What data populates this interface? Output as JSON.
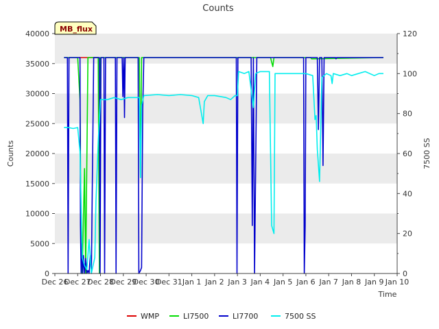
{
  "chart_data": {
    "type": "line",
    "title": "Counts",
    "badge": "MB_flux",
    "xlabel": "Time",
    "ylabel_left": "Counts",
    "ylabel_right": "7500 SS",
    "ylim_left": [
      0,
      40000
    ],
    "ylim_right": [
      0,
      120
    ],
    "xlim": [
      0,
      15
    ],
    "grid": "horizontal bands",
    "legend_position": "bottom",
    "x_ticks": [
      {
        "pos": 0,
        "label": "Dec 26"
      },
      {
        "pos": 1,
        "label": "Dec 27"
      },
      {
        "pos": 2,
        "label": "Dec 28"
      },
      {
        "pos": 3,
        "label": "Dec 29"
      },
      {
        "pos": 4,
        "label": "Dec 30"
      },
      {
        "pos": 5,
        "label": "Dec 31"
      },
      {
        "pos": 6,
        "label": "Jan 1"
      },
      {
        "pos": 7,
        "label": "Jan 2"
      },
      {
        "pos": 8,
        "label": "Jan 3"
      },
      {
        "pos": 9,
        "label": "Jan 4"
      },
      {
        "pos": 10,
        "label": "Jan 5"
      },
      {
        "pos": 11,
        "label": "Jan 6"
      },
      {
        "pos": 12,
        "label": "Jan 7"
      },
      {
        "pos": 13,
        "label": "Jan 8"
      },
      {
        "pos": 14,
        "label": "Jan 9"
      },
      {
        "pos": 15,
        "label": "Jan 10"
      }
    ],
    "y_ticks_left": [
      0,
      5000,
      10000,
      15000,
      20000,
      25000,
      30000,
      35000,
      40000
    ],
    "y_ticks_right": [
      0,
      20,
      40,
      60,
      80,
      100,
      120
    ],
    "series": [
      {
        "name": "WMP",
        "color": "#dd0000",
        "axis": "left",
        "points": [
          [
            1.05,
            36000
          ],
          [
            1.9,
            36000
          ]
        ]
      },
      {
        "name": "LI7500",
        "color": "#00dd00",
        "axis": "left",
        "points": [
          [
            0.4,
            36000
          ],
          [
            1.0,
            36000
          ],
          [
            1.1,
            29000
          ],
          [
            1.15,
            4000
          ],
          [
            1.2,
            0
          ],
          [
            1.3,
            17500
          ],
          [
            1.35,
            0
          ],
          [
            1.45,
            36000
          ],
          [
            1.9,
            36000
          ],
          [
            1.95,
            0
          ],
          [
            2.0,
            36000
          ],
          [
            3.7,
            36000
          ],
          [
            3.75,
            16000
          ],
          [
            3.8,
            36000
          ],
          [
            9.45,
            36000
          ],
          [
            9.55,
            34500
          ],
          [
            9.6,
            36000
          ],
          [
            11.2,
            36000
          ],
          [
            11.25,
            35800
          ],
          [
            14.4,
            36000
          ]
        ]
      },
      {
        "name": "LI7700",
        "color": "#0000cc",
        "axis": "left",
        "points": [
          [
            0.4,
            36000
          ],
          [
            0.55,
            36000
          ],
          [
            0.58,
            0
          ],
          [
            0.62,
            36000
          ],
          [
            1.1,
            36000
          ],
          [
            1.12,
            8000
          ],
          [
            1.15,
            0
          ],
          [
            1.18,
            5000
          ],
          [
            1.22,
            0
          ],
          [
            1.25,
            3000
          ],
          [
            1.3,
            0
          ],
          [
            1.35,
            2500
          ],
          [
            1.4,
            0
          ],
          [
            1.45,
            500
          ],
          [
            1.5,
            0
          ],
          [
            1.55,
            3000
          ],
          [
            1.6,
            0
          ],
          [
            1.7,
            36000
          ],
          [
            1.95,
            36000
          ],
          [
            1.98,
            0
          ],
          [
            2.02,
            36000
          ],
          [
            2.15,
            36000
          ],
          [
            2.18,
            0
          ],
          [
            2.22,
            36000
          ],
          [
            2.65,
            36000
          ],
          [
            2.68,
            0
          ],
          [
            2.72,
            36000
          ],
          [
            2.95,
            36000
          ],
          [
            2.98,
            29500
          ],
          [
            3.02,
            36000
          ],
          [
            3.05,
            26000
          ],
          [
            3.08,
            36000
          ],
          [
            3.65,
            36000
          ],
          [
            3.68,
            0
          ],
          [
            3.75,
            500
          ],
          [
            3.8,
            1000
          ],
          [
            3.85,
            27500
          ],
          [
            3.9,
            36000
          ],
          [
            7.95,
            36000
          ],
          [
            7.98,
            0
          ],
          [
            8.02,
            36000
          ],
          [
            8.6,
            36000
          ],
          [
            8.65,
            8000
          ],
          [
            8.7,
            36000
          ],
          [
            8.75,
            0
          ],
          [
            8.8,
            17500
          ],
          [
            8.85,
            36000
          ],
          [
            9.0,
            36000
          ],
          [
            9.05,
            36000
          ],
          [
            9.8,
            36000
          ],
          [
            10.9,
            36000
          ],
          [
            10.93,
            0
          ],
          [
            10.97,
            8000
          ],
          [
            11.0,
            36000
          ],
          [
            11.5,
            36000
          ],
          [
            11.55,
            24000
          ],
          [
            11.6,
            36000
          ],
          [
            11.7,
            36000
          ],
          [
            11.75,
            18000
          ],
          [
            11.8,
            36000
          ],
          [
            12.3,
            36000
          ],
          [
            12.32,
            35800
          ],
          [
            12.35,
            36000
          ],
          [
            14.4,
            36000
          ]
        ]
      },
      {
        "name": "7500 SS",
        "color": "#00eeee",
        "axis": "right",
        "points": [
          [
            0.4,
            73
          ],
          [
            0.6,
            73
          ],
          [
            0.8,
            72.5
          ],
          [
            1.0,
            73
          ],
          [
            1.1,
            61
          ],
          [
            1.2,
            8
          ],
          [
            1.3,
            4
          ],
          [
            1.4,
            2
          ],
          [
            1.5,
            17
          ],
          [
            1.6,
            0
          ],
          [
            1.75,
            8
          ],
          [
            1.8,
            36
          ],
          [
            1.9,
            66
          ],
          [
            2.0,
            87
          ],
          [
            2.3,
            87
          ],
          [
            2.6,
            88
          ],
          [
            2.9,
            87
          ],
          [
            3.2,
            88
          ],
          [
            3.7,
            88
          ],
          [
            3.75,
            48
          ],
          [
            3.8,
            84
          ],
          [
            3.9,
            89
          ],
          [
            4.5,
            89.5
          ],
          [
            5.0,
            89
          ],
          [
            5.5,
            89.5
          ],
          [
            6.0,
            89
          ],
          [
            6.3,
            88
          ],
          [
            6.5,
            75
          ],
          [
            6.55,
            86
          ],
          [
            6.7,
            89
          ],
          [
            7.0,
            89
          ],
          [
            7.5,
            88
          ],
          [
            7.7,
            87
          ],
          [
            7.9,
            89
          ],
          [
            8.0,
            89
          ],
          [
            8.05,
            101
          ],
          [
            8.3,
            100
          ],
          [
            8.5,
            101
          ],
          [
            8.7,
            83
          ],
          [
            8.8,
            100
          ],
          [
            9.0,
            101
          ],
          [
            9.2,
            101
          ],
          [
            9.4,
            101
          ],
          [
            9.5,
            24
          ],
          [
            9.6,
            20
          ],
          [
            9.65,
            100
          ],
          [
            9.8,
            100
          ],
          [
            10.2,
            100
          ],
          [
            10.6,
            100
          ],
          [
            11.0,
            100
          ],
          [
            11.3,
            99
          ],
          [
            11.4,
            77
          ],
          [
            11.45,
            79
          ],
          [
            11.5,
            62
          ],
          [
            11.6,
            46
          ],
          [
            11.7,
            98
          ],
          [
            11.9,
            100
          ],
          [
            12.1,
            99
          ],
          [
            12.15,
            95
          ],
          [
            12.2,
            100
          ],
          [
            12.5,
            99
          ],
          [
            12.8,
            100
          ],
          [
            13.0,
            99
          ],
          [
            13.3,
            100
          ],
          [
            13.6,
            101
          ],
          [
            14.0,
            99
          ],
          [
            14.2,
            100
          ],
          [
            14.4,
            100
          ]
        ]
      }
    ]
  }
}
